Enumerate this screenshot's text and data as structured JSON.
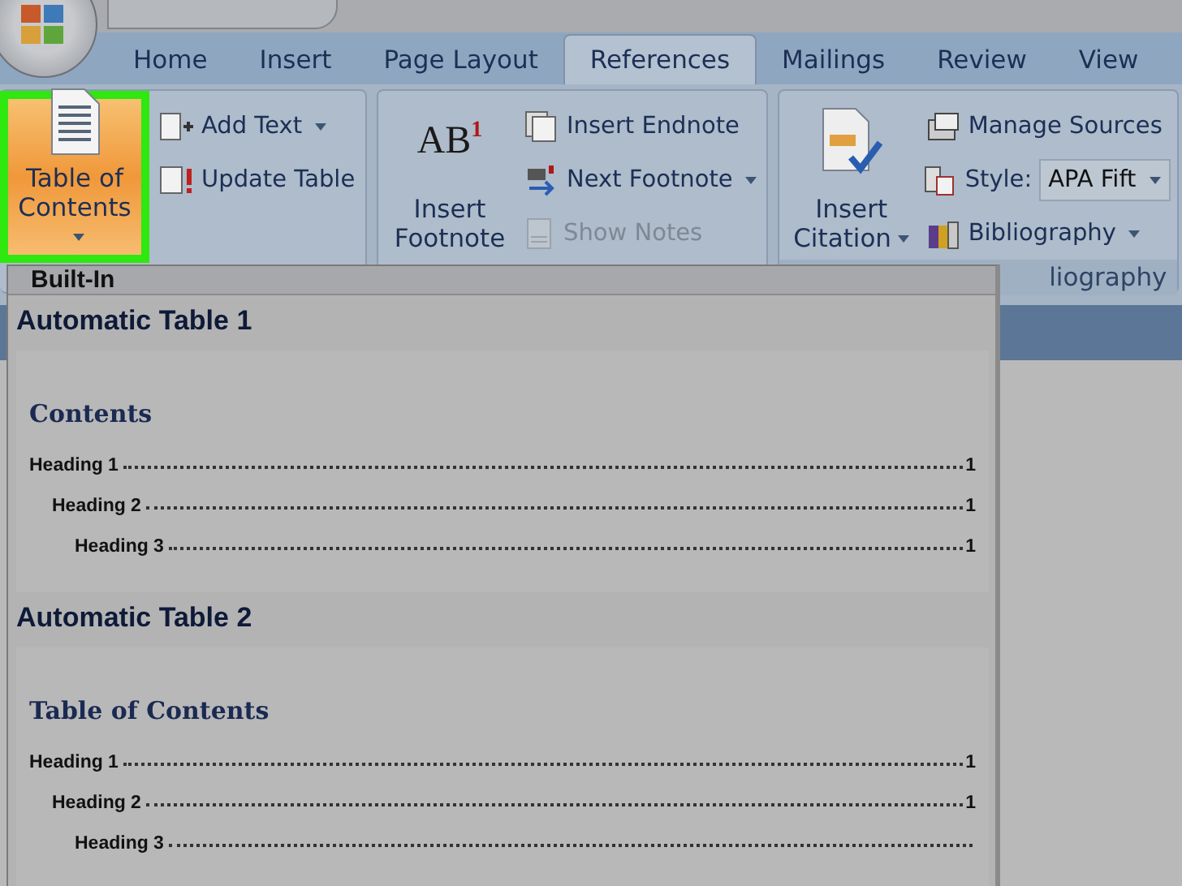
{
  "tabs": [
    {
      "label": "Home",
      "selected": false
    },
    {
      "label": "Insert",
      "selected": false
    },
    {
      "label": "Page Layout",
      "selected": false
    },
    {
      "label": "References",
      "selected": true
    },
    {
      "label": "Mailings",
      "selected": false
    },
    {
      "label": "Review",
      "selected": false
    },
    {
      "label": "View",
      "selected": false
    }
  ],
  "ribbon": {
    "groups": [
      {
        "large_button": {
          "label": "Table of Contents",
          "dropdown": true,
          "highlighted": true
        },
        "small_buttons": [
          {
            "kind": "button",
            "label": "Add Text",
            "dropdown": true,
            "disabled": false
          },
          {
            "kind": "button",
            "label": "Update Table",
            "disabled": false
          }
        ]
      },
      {
        "large_button": {
          "label": "Insert Footnote",
          "glyph": "AB",
          "glyph_mark": "1",
          "highlighted": false
        },
        "small_buttons": [
          {
            "kind": "button",
            "label": "Insert Endnote",
            "disabled": false
          },
          {
            "kind": "button",
            "label": "Next Footnote",
            "dropdown": true,
            "disabled": false
          },
          {
            "kind": "button",
            "label": "Show Notes",
            "disabled": true
          }
        ]
      },
      {
        "label": "liography",
        "large_button": {
          "label": "Insert Citation",
          "dropdown": true,
          "highlighted": false
        },
        "small_buttons": [
          {
            "kind": "button",
            "label": "Manage Sources",
            "disabled": false
          },
          {
            "kind": "select",
            "label": "Style:",
            "value": "APA Fift",
            "dropdown": true
          },
          {
            "kind": "button",
            "label": "Bibliography",
            "dropdown": true,
            "disabled": false
          }
        ]
      }
    ]
  },
  "gallery": {
    "header": "Built-In",
    "items": [
      {
        "title": "Automatic Table 1",
        "preview": {
          "heading": "Contents",
          "entries": [
            {
              "text": "Heading 1",
              "page": "1",
              "children": [
                {
                  "text": "Heading 2",
                  "page": "1",
                  "children": [
                    {
                      "text": "Heading 3",
                      "page": "1"
                    }
                  ]
                }
              ]
            }
          ]
        }
      },
      {
        "title": "Automatic Table 2",
        "preview": {
          "heading": "Table of Contents",
          "entries": [
            {
              "text": "Heading 1",
              "page": "1",
              "children": [
                {
                  "text": "Heading 2",
                  "page": "1",
                  "children": [
                    {
                      "text": "Heading 3"
                    }
                  ]
                }
              ]
            }
          ]
        }
      }
    ]
  }
}
